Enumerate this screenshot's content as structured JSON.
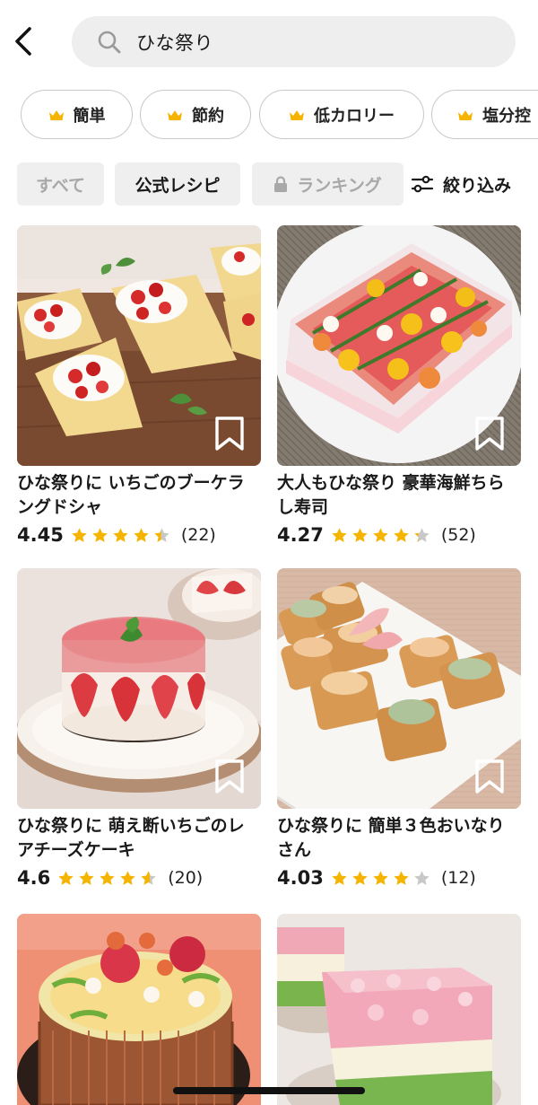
{
  "search": {
    "query": "ひな祭り"
  },
  "chips": [
    {
      "label": "簡単"
    },
    {
      "label": "節約"
    },
    {
      "label": "低カロリー"
    },
    {
      "label": "塩分控"
    }
  ],
  "tabs": {
    "all": "すべて",
    "official": "公式レシピ",
    "ranking": "ランキング",
    "filter": "絞り込み"
  },
  "colors": {
    "accent": "#f5b400",
    "star_empty": "#c8c8c8",
    "chip_border": "#c9c9c9"
  },
  "recipes": [
    {
      "title": "ひな祭りに いちごのブーケラングドシャ",
      "rating": "4.45",
      "rating_value": 4.45,
      "count": "(22)"
    },
    {
      "title": "大人もひな祭り 豪華海鮮ちらし寿司",
      "rating": "4.27",
      "rating_value": 4.27,
      "count": "(52)"
    },
    {
      "title": "ひな祭りに 萌え断いちごのレアチーズケーキ",
      "rating": "4.6",
      "rating_value": 4.6,
      "count": "(20)"
    },
    {
      "title": "ひな祭りに 簡単３色おいなりさん",
      "rating": "4.03",
      "rating_value": 4.03,
      "count": "(12)"
    },
    {
      "title": "",
      "rating": "",
      "rating_value": null,
      "count": ""
    },
    {
      "title": "",
      "rating": "",
      "rating_value": null,
      "count": ""
    }
  ]
}
